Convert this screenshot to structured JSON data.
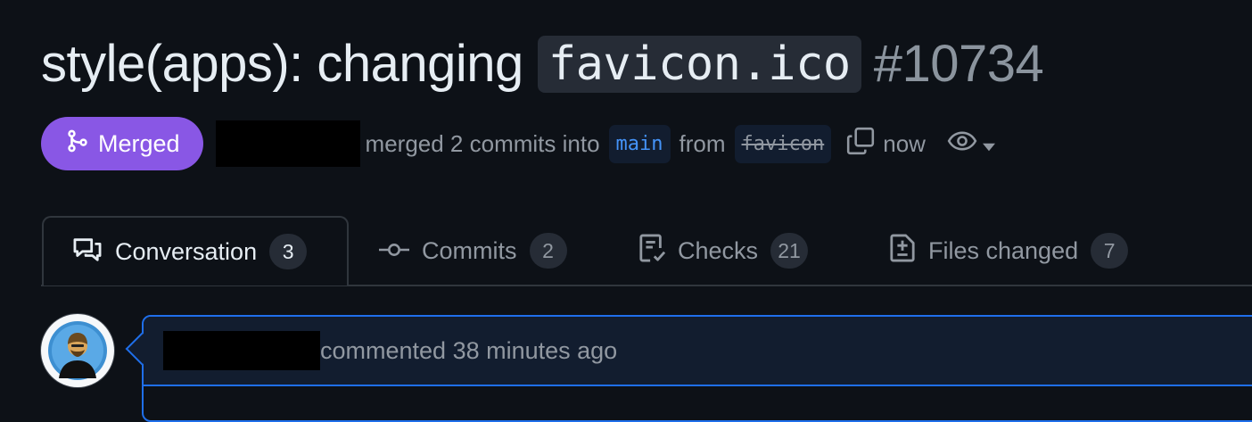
{
  "pr": {
    "title_prefix": "style(apps): changing",
    "title_code": "favicon.ico",
    "number": "#10734"
  },
  "meta": {
    "status": "Merged",
    "action_text": "merged 2 commits into",
    "base_branch": "main",
    "from_text": "from",
    "head_branch": "favicon",
    "time": "now"
  },
  "tabs": [
    {
      "label": "Conversation",
      "count": "3",
      "icon": "comment-discussion-icon"
    },
    {
      "label": "Commits",
      "count": "2",
      "icon": "git-commit-icon"
    },
    {
      "label": "Checks",
      "count": "21",
      "icon": "checklist-icon"
    },
    {
      "label": "Files changed",
      "count": "7",
      "icon": "file-diff-icon"
    }
  ],
  "comment": {
    "header_text": "commented 38 minutes ago"
  },
  "colors": {
    "background": "#0d1117",
    "merged": "#8957e5",
    "accent_blue": "#1f6feb"
  }
}
